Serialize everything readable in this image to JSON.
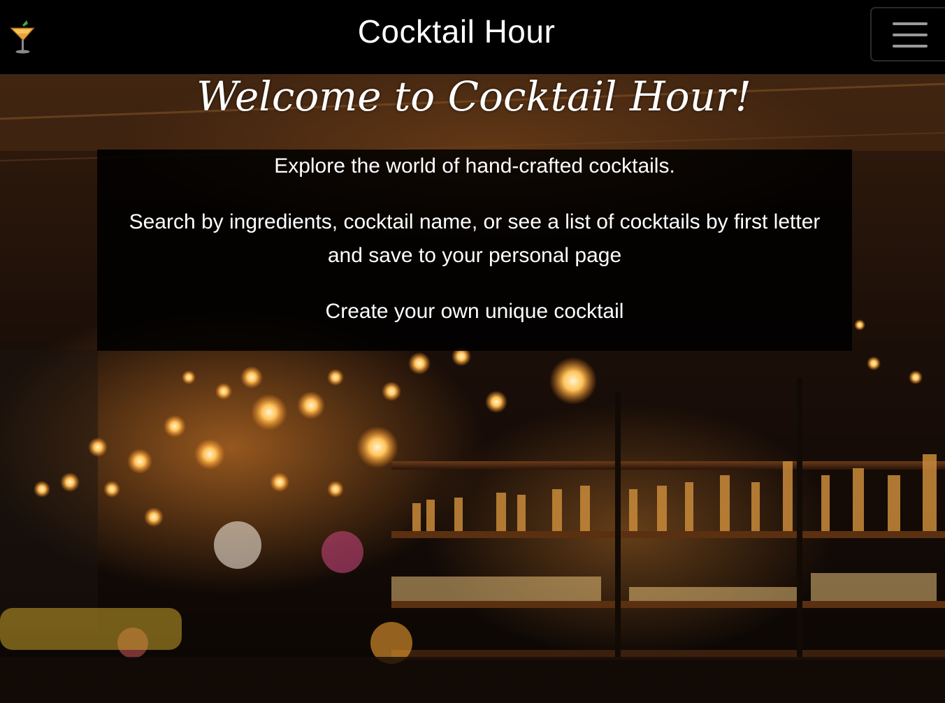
{
  "navbar": {
    "brand": "Cocktail Hour",
    "logo_icon": "cocktail-glass-icon",
    "menu_icon": "hamburger-menu-icon"
  },
  "hero": {
    "heading": "Welcome to Cocktail Hour!",
    "paragraphs": [
      "Explore the world of hand-crafted cocktails.",
      "Search by ingredients, cocktail name, or see a list of cocktails by first letter and save to your personal page",
      "Create your own unique cocktail"
    ]
  },
  "colors": {
    "navbar_bg": "#000000",
    "text": "#ffffff",
    "menu_bars": "#9a9a9a",
    "warm_light": "#ffb24a"
  }
}
